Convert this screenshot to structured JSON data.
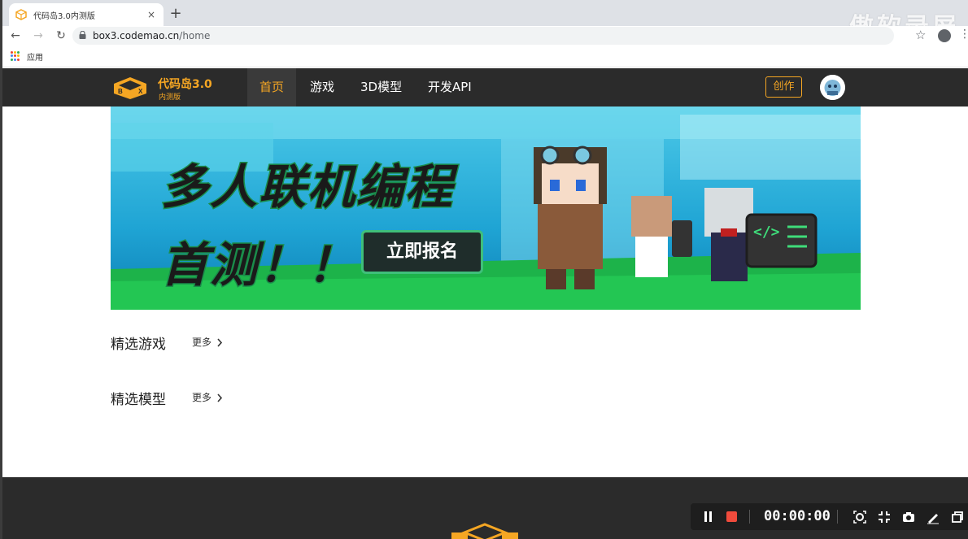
{
  "browser": {
    "tab_title": "代码岛3.0内测版",
    "tab_close": "×",
    "new_tab": "+",
    "url_host": "box3.codemao.cn",
    "url_path": "/home",
    "back": "←",
    "forward": "→",
    "reload": "↻",
    "lock": "🔒",
    "star": "☆",
    "menu": "⋮",
    "bookmark_apps_label": "应用"
  },
  "watermark": "傲软录屏",
  "site": {
    "brand_name": "代码岛3.0",
    "brand_sub": "内测版",
    "nav": [
      {
        "label": "首页",
        "active": true
      },
      {
        "label": "游戏",
        "active": false
      },
      {
        "label": "3D模型",
        "active": false
      },
      {
        "label": "开发API",
        "active": false
      }
    ],
    "create_label": "创作",
    "accent_color": "#f5a623",
    "header_color": "#2b2b2b"
  },
  "banner": {
    "title": "多人联机编程",
    "subtitle": "首测！！",
    "cta": "立即报名",
    "code_symbol": "</>"
  },
  "sections": [
    {
      "title": "精选游戏",
      "more": "更多"
    },
    {
      "title": "精选模型",
      "more": "更多"
    }
  ],
  "recorder": {
    "time": "00:00:00",
    "stop_color": "#f04b3c"
  },
  "icons": [
    "favicon-icon",
    "back-icon",
    "forward-icon",
    "reload-icon",
    "lock-icon",
    "star-icon",
    "profile-icon",
    "menu-icon",
    "apps-icon",
    "logo-icon",
    "chevron-right-icon",
    "pause-icon",
    "stop-icon",
    "screenshot-icon",
    "collapse-icon",
    "camera-icon",
    "pen-icon",
    "window-icon"
  ]
}
